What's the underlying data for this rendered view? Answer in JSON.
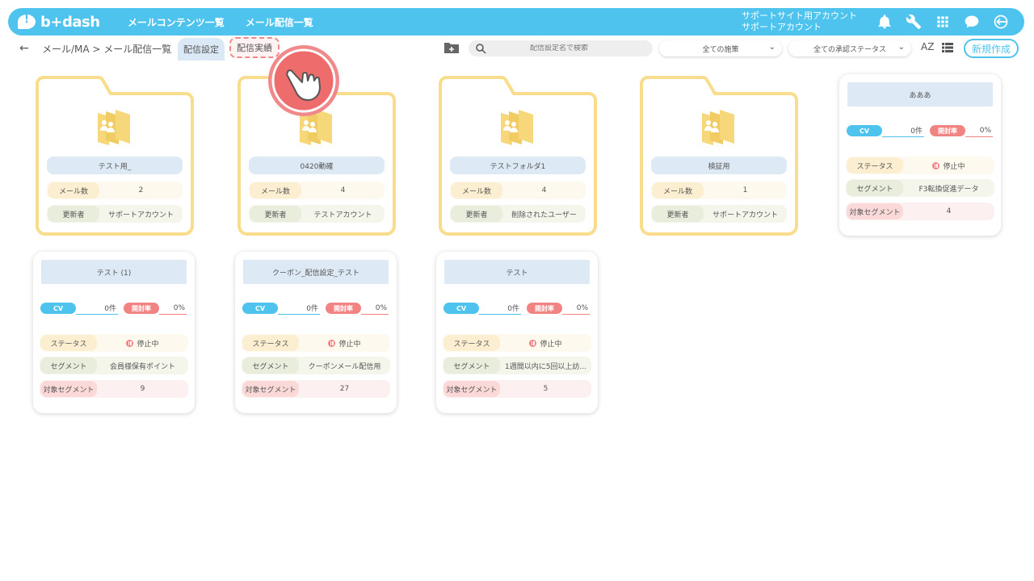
{
  "header": {
    "logo": "b+dash",
    "nav": [
      "メールコンテンツ一覧",
      "メール配信一覧"
    ],
    "account_line1": "サポートサイト用アカウント",
    "account_line2": "サポートアカウント"
  },
  "toolbar": {
    "back": "←",
    "breadcrumb": "メール/MA > メール配信一覧",
    "tab_setting": "配信設定",
    "tab_result": "配信実績",
    "search_placeholder": "配信設定名で検索",
    "filter_policy": "全ての施策",
    "filter_status": "全ての承認ステータス",
    "sort_label": "AZ",
    "new_button": "新規作成"
  },
  "folders": [
    {
      "title": "テスト用_",
      "mail_label": "メール数",
      "mail_count": "2",
      "updater_label": "更新者",
      "updater": "サポートアカウント"
    },
    {
      "title": "0420動確",
      "mail_label": "メール数",
      "mail_count": "4",
      "updater_label": "更新者",
      "updater": "テストアカウント"
    },
    {
      "title": "テストフォルダ1",
      "mail_label": "メール数",
      "mail_count": "4",
      "updater_label": "更新者",
      "updater": "削除されたユーザー"
    },
    {
      "title": "検証用",
      "mail_label": "メール数",
      "mail_count": "1",
      "updater_label": "更新者",
      "updater": "サポートアカウント"
    }
  ],
  "cards": [
    {
      "title": "あああ",
      "cv_label": "CV",
      "cv": "0件",
      "open_label": "開封率",
      "open": "0%",
      "status_label": "ステータス",
      "status": "停止中",
      "segment_label": "セグメント",
      "segment": "F3転換促進データ",
      "target_label": "対象セグメント",
      "target": "4"
    },
    {
      "title": "テスト (1)",
      "cv_label": "CV",
      "cv": "0件",
      "open_label": "開封率",
      "open": "0%",
      "status_label": "ステータス",
      "status": "停止中",
      "segment_label": "セグメント",
      "segment": "会員様保有ポイント",
      "target_label": "対象セグメント",
      "target": "9"
    },
    {
      "title": "クーポン_配信設定_テスト",
      "cv_label": "CV",
      "cv": "0件",
      "open_label": "開封率",
      "open": "0%",
      "status_label": "ステータス",
      "status": "停止中",
      "segment_label": "セグメント",
      "segment": "クーポンメール配信用",
      "target_label": "対象セグメント",
      "target": "27"
    },
    {
      "title": "テスト",
      "cv_label": "CV",
      "cv": "0件",
      "open_label": "開封率",
      "open": "0%",
      "status_label": "ステータス",
      "status": "停止中",
      "segment_label": "セグメント",
      "segment": "1週間以内に5回以上訪...",
      "target_label": "対象セグメント",
      "target": "5"
    }
  ],
  "colors": {
    "brand": "#4dc3ee",
    "folder": "#f9dc8c",
    "accent_red": "#f28383"
  }
}
